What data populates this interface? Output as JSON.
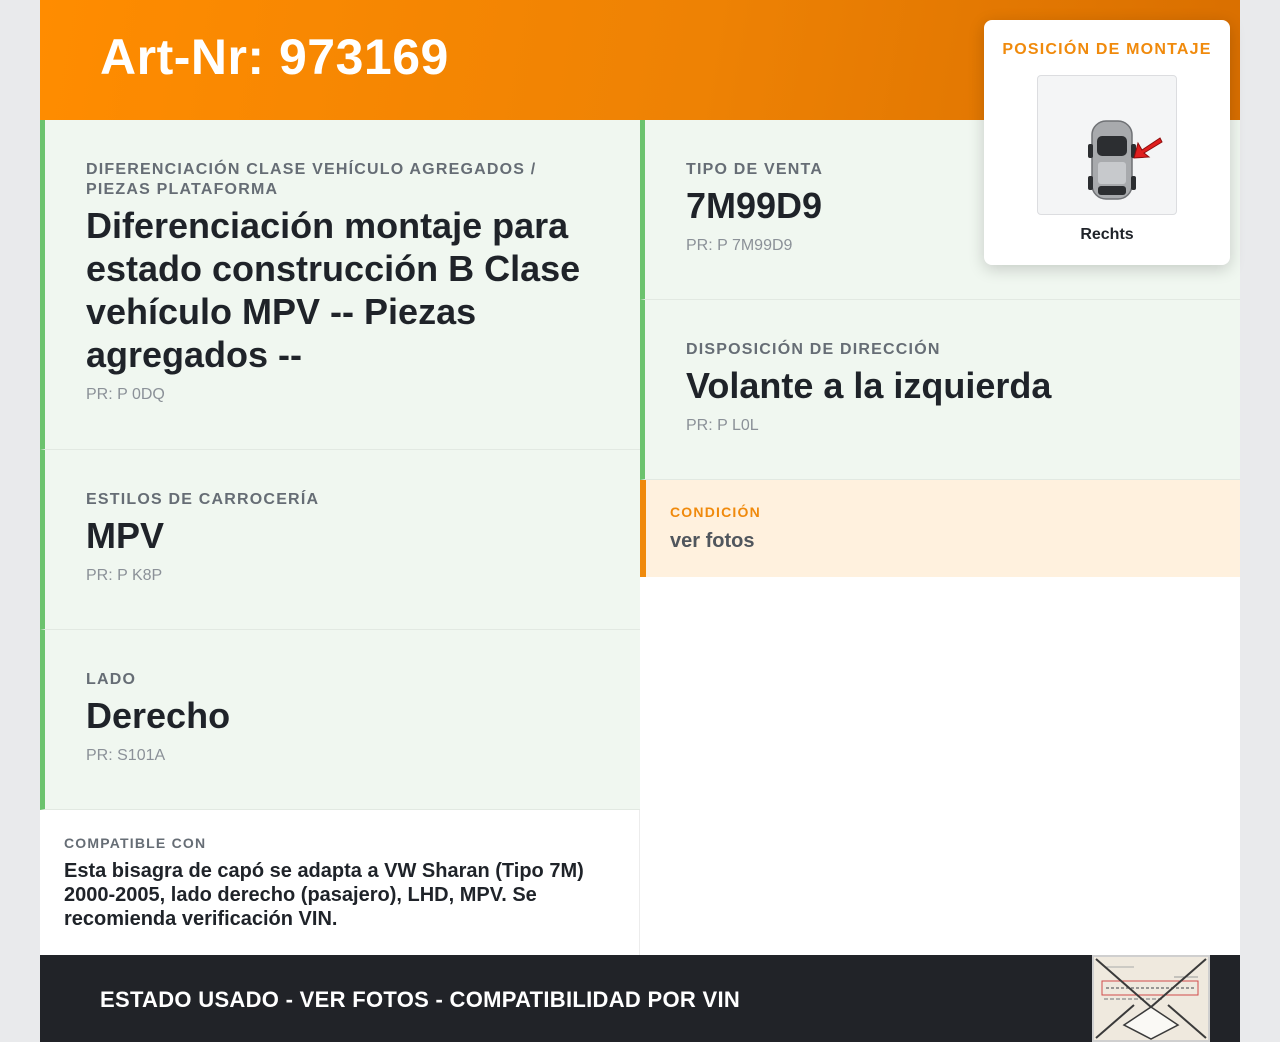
{
  "header": {
    "title": "Art-Nr: 973169"
  },
  "cells": [
    {
      "label": "DIFERENCIACIÓN CLASE VEHÍCULO AGREGADOS / PIEZAS PLATAFORMA",
      "value": "Diferenciación montaje para estado construcción B Clase vehículo MPV -- Piezas agregados --",
      "pr": "PR: P 0DQ"
    },
    {
      "label": "ESTILOS DE CARROCERÍA",
      "value": "MPV",
      "pr": "PR: P K8P"
    },
    {
      "label": "LADO",
      "value": "Derecho",
      "pr": "PR: S101A"
    },
    {
      "label": "TIPO DE VENTA",
      "value": "7M99D9",
      "pr": "PR: P 7M99D9"
    },
    {
      "label": "DISPOSICIÓN DE DIRECCIÓN",
      "value": "Volante a la izquierda",
      "pr": "PR: P L0L"
    }
  ],
  "condition": {
    "label": "CONDICIÓN",
    "text": "ver fotos"
  },
  "compatibility": {
    "label": "COMPATIBLE CON",
    "text": "Esta bisagra de capó se adapta a VW Sharan (Tipo 7M) 2000-2005, lado derecho (pasajero), LHD, MPV. Se recomienda verificación VIN."
  },
  "mount_position": {
    "title": "POSICIÓN DE MONTAJE",
    "caption": "Rechts",
    "image": "car-top-view-with-arrow"
  },
  "footer": {
    "text": "ESTADO USADO - VER FOTOS - COMPATIBILIDAD POR VIN",
    "thumbnail": "label-photo-thumbnail"
  },
  "colors": {
    "accent": "#f08a0c",
    "green": "#6cc36e",
    "cell_bg": "#f0f7f0",
    "footer_bg": "#212328"
  }
}
